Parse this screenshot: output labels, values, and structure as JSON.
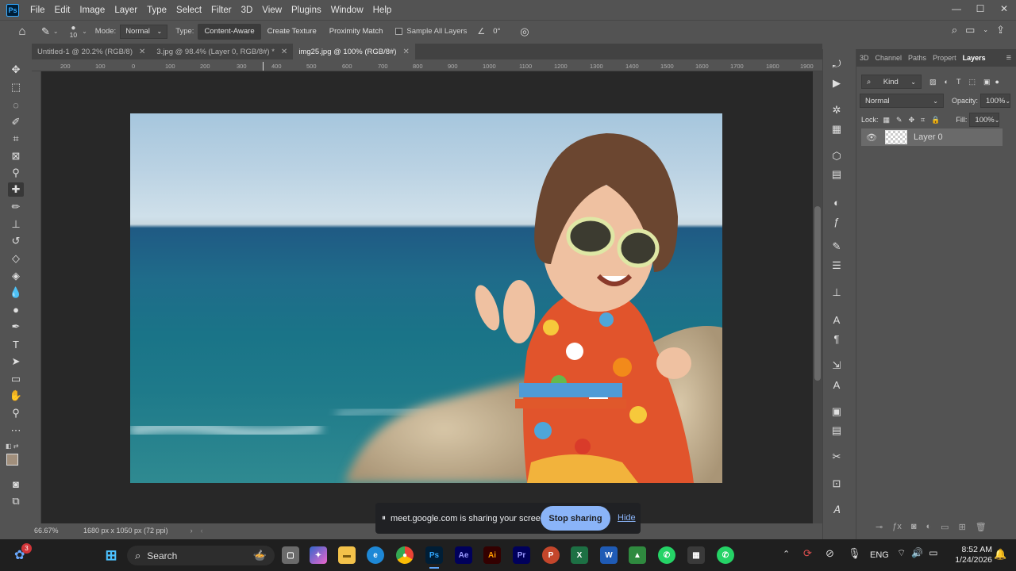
{
  "app": {
    "logo": "Ps"
  },
  "menu": [
    "File",
    "Edit",
    "Image",
    "Layer",
    "Type",
    "Select",
    "Filter",
    "3D",
    "View",
    "Plugins",
    "Window",
    "Help"
  ],
  "window_controls": {
    "minimize": "—",
    "restore": "☐",
    "close": "✕"
  },
  "options": {
    "brush_size": "10",
    "mode_label": "Mode:",
    "mode_value": "Normal",
    "type_label": "Type:",
    "type_options": [
      "Content-Aware",
      "Create Texture",
      "Proximity Match"
    ],
    "sample_all_layers": "Sample All Layers",
    "angle": "0°"
  },
  "tabs": [
    {
      "label": "Untitled-1 @ 20.2% (RGB/8)"
    },
    {
      "label": "3.jpg @ 98.4% (Layer 0, RGB/8#) *"
    },
    {
      "label": "img25.jpg @ 100% (RGB/8#)"
    }
  ],
  "ruler_top": [
    "200",
    "100",
    "0",
    "100",
    "200",
    "300",
    "400",
    "500",
    "600",
    "700",
    "800",
    "900",
    "1000",
    "1100",
    "1200",
    "1300",
    "1400",
    "1500",
    "1600",
    "1700",
    "1800",
    "1900"
  ],
  "status": {
    "zoom": "66.67%",
    "doc_info": "1680 px x 1050 px (72 ppi)"
  },
  "panel": {
    "tabs": [
      "3D",
      "Channel",
      "Paths",
      "Propert",
      "Layers"
    ],
    "filter": "Kind",
    "blend_mode": "Normal",
    "opacity_label": "Opacity:",
    "opacity_value": "100%",
    "lock_label": "Lock:",
    "fill_label": "Fill:",
    "fill_value": "100%",
    "layer_name": "Layer 0"
  },
  "share": {
    "message": "meet.google.com is sharing your screen.",
    "stop": "Stop sharing",
    "hide": "Hide"
  },
  "taskbar": {
    "search": "Search",
    "lang": "ENG",
    "time": "8:52 AM",
    "date": "1/24/2026",
    "badge": "3"
  }
}
